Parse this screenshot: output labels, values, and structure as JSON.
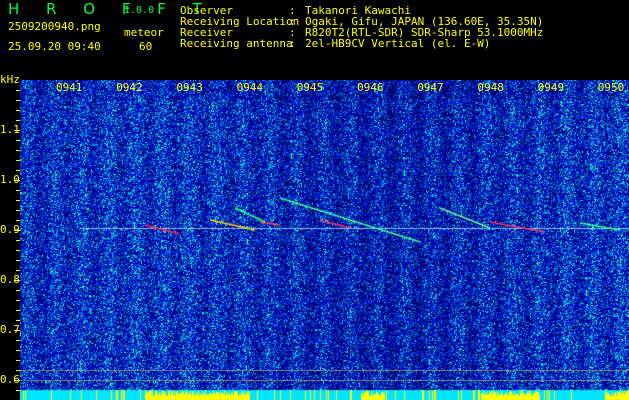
{
  "header": {
    "app_name": "H R O F F T",
    "version": "1.0.0",
    "filename": "2509200940.png",
    "datetime": "25.09.20 09:40",
    "mode_label": "meteor",
    "mode_value": "60"
  },
  "info": [
    {
      "label": "Observer",
      "value": "Takanori Kawachi"
    },
    {
      "label": "Receiving Location",
      "value": "Ogaki, Gifu, JAPAN (136.60E, 35.35N)"
    },
    {
      "label": "Receiver",
      "value": "R820T2(RTL-SDR) SDR-Sharp 53.1000MHz"
    },
    {
      "label": "Receiving antenna",
      "value": "2el-HB9CV Vertical (el. E-W)"
    }
  ],
  "spectrogram": {
    "y_unit": "kHz",
    "y_ticks": [
      "1.1",
      "1.0",
      "0.9",
      "0.8",
      "0.7",
      "0.6"
    ],
    "time_labels": [
      "0941",
      "0942",
      "0943",
      "0944",
      "0945",
      "0946",
      "0947",
      "0948",
      "0949",
      "0950"
    ],
    "colors": {
      "background": "#0000a0",
      "signal": "#ff2040",
      "histogram": "#ffff00",
      "baseline": "#00e5ff",
      "text": "#ffff00",
      "logo": "#00ff33"
    }
  }
}
